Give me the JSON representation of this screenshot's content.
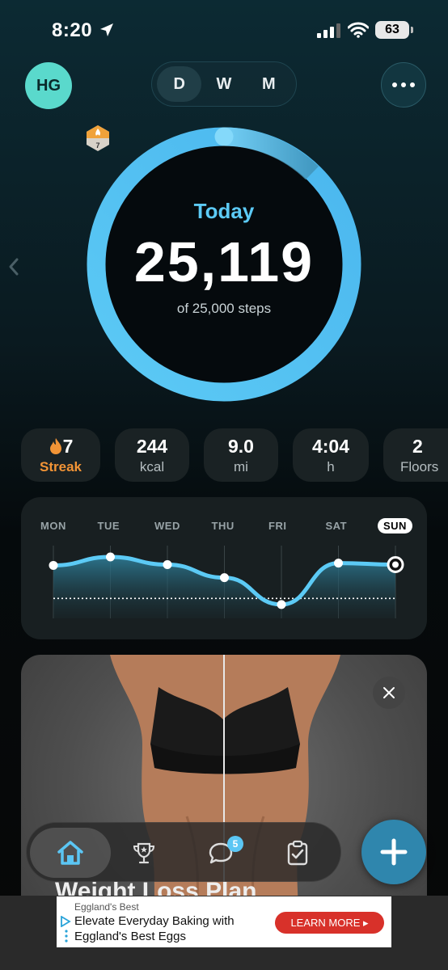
{
  "status_bar": {
    "time": "8:20",
    "battery": "63"
  },
  "header": {
    "avatar_initials": "HG",
    "segments": [
      {
        "label": "D",
        "active": true
      },
      {
        "label": "W",
        "active": false
      },
      {
        "label": "M",
        "active": false
      }
    ]
  },
  "ring": {
    "label": "Today",
    "steps": "25,119",
    "goal_text": "of 25,000 steps",
    "badge_number": "7",
    "progress_fraction": 1.0,
    "accent_color": "#5ccaf5"
  },
  "stats": {
    "streak": {
      "value": "7",
      "label": "Streak"
    },
    "calories": {
      "value": "244",
      "label": "kcal"
    },
    "distance": {
      "value": "9.0",
      "label": "mi"
    },
    "time": {
      "value": "4:04",
      "label": "h"
    },
    "floors": {
      "value": "2",
      "label": "Floors"
    }
  },
  "weekly": {
    "days": [
      "MON",
      "TUE",
      "WED",
      "THU",
      "FRI",
      "SAT",
      "SUN"
    ],
    "active_day": "SUN"
  },
  "chart_data": {
    "type": "area",
    "categories": [
      "MON",
      "TUE",
      "WED",
      "THU",
      "FRI",
      "SAT",
      "SUN"
    ],
    "values": [
      0.69,
      0.8,
      0.7,
      0.53,
      0.18,
      0.72,
      0.7
    ],
    "goal_line": 0.26,
    "title": "",
    "xlabel": "",
    "ylabel": ""
  },
  "promo": {
    "title": "Weight Loss Plan"
  },
  "tabbar": {
    "messages_badge": "5"
  },
  "ad": {
    "brand": "Eggland's Best",
    "text": "Elevate Everyday Baking with Eggland's Best Eggs",
    "cta": "LEARN MORE"
  }
}
